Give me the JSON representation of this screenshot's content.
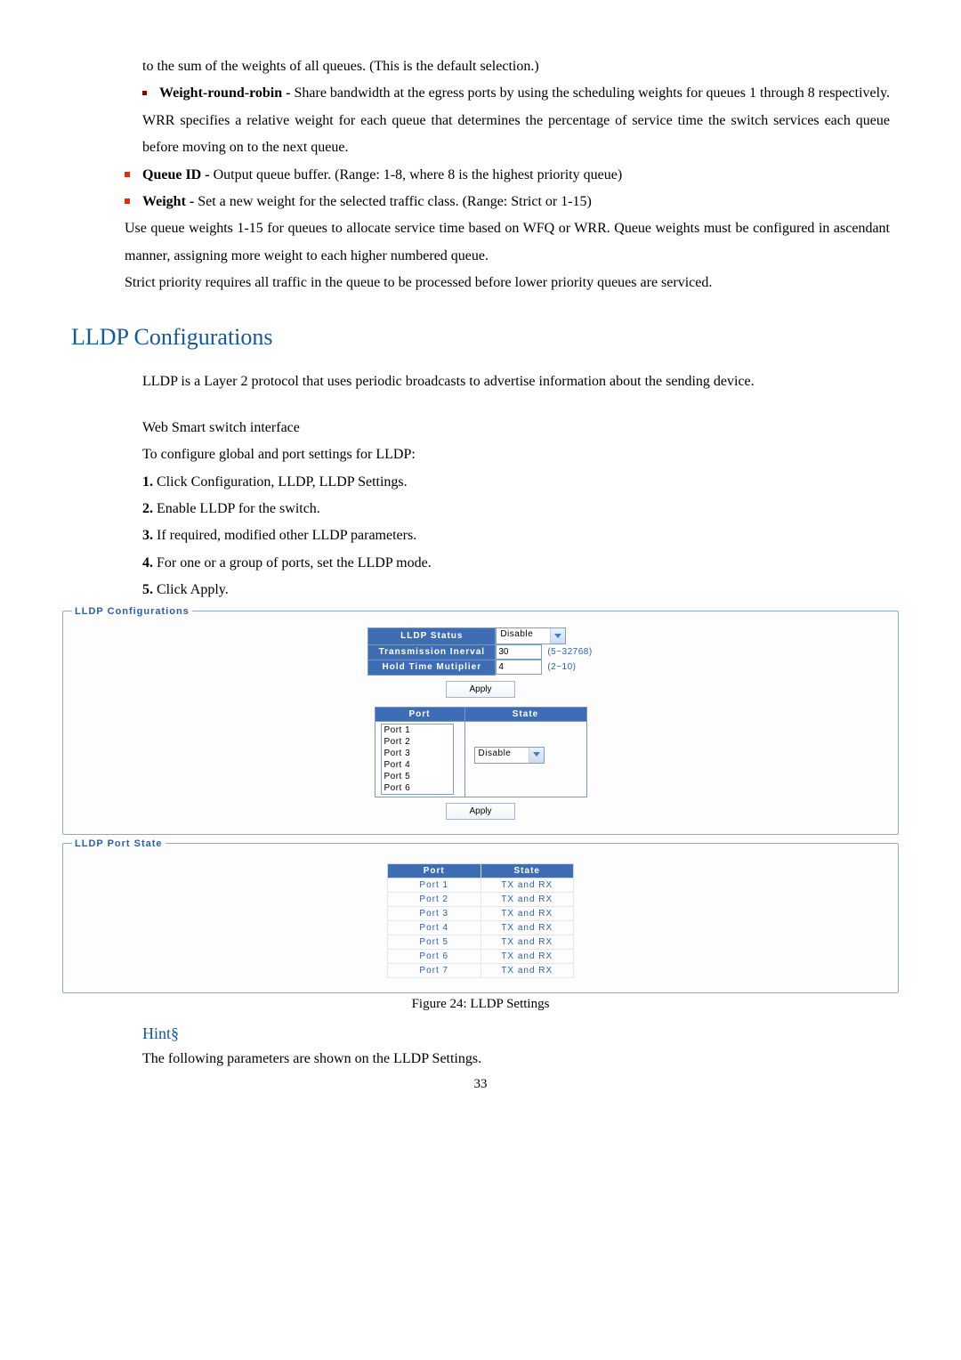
{
  "top_paragraphs": {
    "line1": "to the sum of the weights of all queues. (This is the default selection.)",
    "wrr_bold": "Weight-round-robin -",
    "wrr_rest": " Share bandwidth at the egress ports by using the scheduling weights for queues 1 through 8 respectively. WRR specifies a relative weight for each queue that determines the percentage of service time the switch services each queue before moving on to the next queue.",
    "queueid_bold": "Queue ID -",
    "queueid_rest": " Output queue buffer. (Range: 1-8, where 8 is the highest priority queue)",
    "weight_bold": "Weight -",
    "weight_rest": " Set a new weight for the selected traffic class. (Range: Strict or 1-15)",
    "use_queue": "Use queue weights 1-15 for queues to allocate service time based on WFQ or WRR. Queue weights must be configured in ascendant manner, assigning more weight to each higher numbered queue.",
    "strict": "Strict priority requires all traffic in the queue to be processed before lower priority queues are serviced."
  },
  "section_title": "LLDP Configurations",
  "lldp_intro": "LLDP is a Layer 2 protocol that uses periodic broadcasts to advertise information about the sending device.",
  "web_smart": "Web Smart switch interface",
  "config_intro": "To configure global and port settings for LLDP:",
  "steps": [
    "Click Configuration, LLDP, LLDP Settings.",
    "Enable LLDP for the switch.",
    "If required, modified other LLDP parameters.",
    "For one or a group of ports, set the LLDP mode.",
    "Click Apply."
  ],
  "panel_configs": {
    "legend": "LLDP Configurations",
    "rows": {
      "status_label": "LLDP Status",
      "status_value": "Disable",
      "trans_label": "Transmission Inerval",
      "trans_value": "30",
      "trans_range": "(5~32768)",
      "hold_label": "Hold Time Mutiplier",
      "hold_value": "4",
      "hold_range": "(2~10)"
    },
    "apply": "Apply",
    "grid_port_header": "Port",
    "grid_state_header": "State",
    "port_list": [
      "Port 1",
      "Port 2",
      "Port 3",
      "Port 4",
      "Port 5",
      "Port 6"
    ],
    "state_value": "Disable"
  },
  "panel_portstate": {
    "legend": "LLDP Port State",
    "header_port": "Port",
    "header_state": "State",
    "rows": [
      {
        "port": "Port 1",
        "state": "TX and RX"
      },
      {
        "port": "Port 2",
        "state": "TX and RX"
      },
      {
        "port": "Port 3",
        "state": "TX and RX"
      },
      {
        "port": "Port 4",
        "state": "TX and RX"
      },
      {
        "port": "Port 5",
        "state": "TX and RX"
      },
      {
        "port": "Port 6",
        "state": "TX and RX"
      },
      {
        "port": "Port 7",
        "state": "TX and RX"
      }
    ]
  },
  "figure_caption": "Figure 24: LLDP Settings",
  "hint_title": "Hint§",
  "hint_text": "The following parameters are shown on the LLDP Settings.",
  "page_number": "33"
}
